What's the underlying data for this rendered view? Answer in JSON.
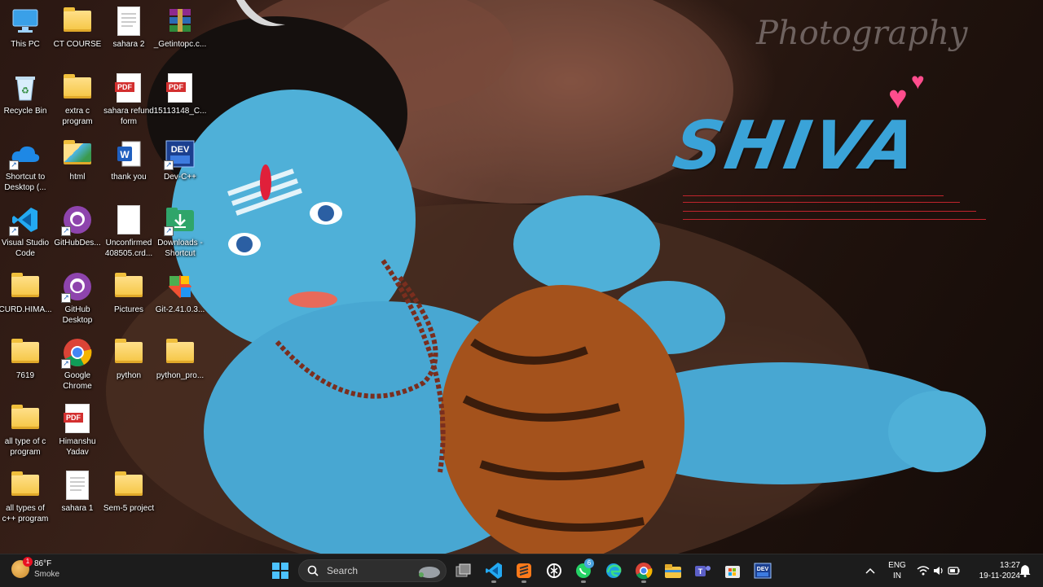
{
  "wallpaper": {
    "title": "SHIVA",
    "subtitle": "Photography"
  },
  "desktop_icons": [
    {
      "label": "This PC",
      "icon": "this-pc-icon"
    },
    {
      "label": "CT COURSE",
      "icon": "folder-icon"
    },
    {
      "label": "sahara 2",
      "icon": "image-file-icon"
    },
    {
      "label": "_Getintopc.c...",
      "icon": "winrar-archive-icon"
    },
    {
      "label": "Recycle Bin",
      "icon": "recycle-bin-icon"
    },
    {
      "label": "extra c program",
      "icon": "folder-icon"
    },
    {
      "label": "sahara refund form",
      "icon": "pdf-icon"
    },
    {
      "label": "15113148_C...",
      "icon": "pdf-icon"
    },
    {
      "label": "Shortcut to Desktop (...",
      "icon": "onedrive-icon"
    },
    {
      "label": "html",
      "icon": "folder-icon"
    },
    {
      "label": "thank you",
      "icon": "word-doc-icon"
    },
    {
      "label": "Dev-C++",
      "icon": "dev-cpp-icon"
    },
    {
      "label": "Visual Studio Code",
      "icon": "vscode-icon"
    },
    {
      "label": "GitHubDes...",
      "icon": "github-icon"
    },
    {
      "label": "Unconfirmed 408505.crd...",
      "icon": "blank-file-icon"
    },
    {
      "label": "Downloads - Shortcut",
      "icon": "downloads-icon"
    },
    {
      "label": "CURD.HIMA...",
      "icon": "folder-icon"
    },
    {
      "label": "GitHub Desktop",
      "icon": "github-icon"
    },
    {
      "label": "Pictures",
      "icon": "folder-icon"
    },
    {
      "label": "Git-2.41.0.3...",
      "icon": "git-installer-icon"
    },
    {
      "label": "7619",
      "icon": "folder-icon"
    },
    {
      "label": "Google Chrome",
      "icon": "chrome-icon"
    },
    {
      "label": "python",
      "icon": "folder-icon"
    },
    {
      "label": "python_pro...",
      "icon": "folder-icon"
    },
    {
      "label": "all type of c program",
      "icon": "folder-icon"
    },
    {
      "label": "Himanshu Yadav",
      "icon": "pdf-icon"
    },
    {
      "label": "all types of c++ program",
      "icon": "folder-icon"
    },
    {
      "label": "sahara 1",
      "icon": "image-file-icon"
    },
    {
      "label": "Sem-5 project",
      "icon": "folder-icon"
    }
  ],
  "taskbar": {
    "weather": {
      "temp": "86°F",
      "condition": "Smoke",
      "badge": "1"
    },
    "search": {
      "placeholder": "Search"
    },
    "apps": [
      {
        "name": "start",
        "icon": "windows-start-icon"
      },
      {
        "name": "task-view",
        "icon": "task-view-icon"
      },
      {
        "name": "vscode",
        "icon": "vscode-icon"
      },
      {
        "name": "sublime",
        "icon": "sublime-text-icon"
      },
      {
        "name": "chatgpt",
        "icon": "chatgpt-icon"
      },
      {
        "name": "whatsapp",
        "icon": "whatsapp-icon",
        "badge": "6"
      },
      {
        "name": "edge",
        "icon": "edge-icon"
      },
      {
        "name": "chrome",
        "icon": "chrome-icon"
      },
      {
        "name": "file-explorer",
        "icon": "file-explorer-icon"
      },
      {
        "name": "teams",
        "icon": "teams-icon"
      },
      {
        "name": "store",
        "icon": "microsoft-store-icon"
      },
      {
        "name": "dev-cpp",
        "icon": "dev-cpp-icon"
      }
    ],
    "tray": {
      "lang_line1": "ENG",
      "lang_line2": "IN",
      "time": "13:27",
      "date": "19-11-2024"
    }
  },
  "colors": {
    "taskbar_bg": "#1c1c1c",
    "title_blue": "#3aa3d8",
    "heart_pink": "#ff4d8d"
  }
}
